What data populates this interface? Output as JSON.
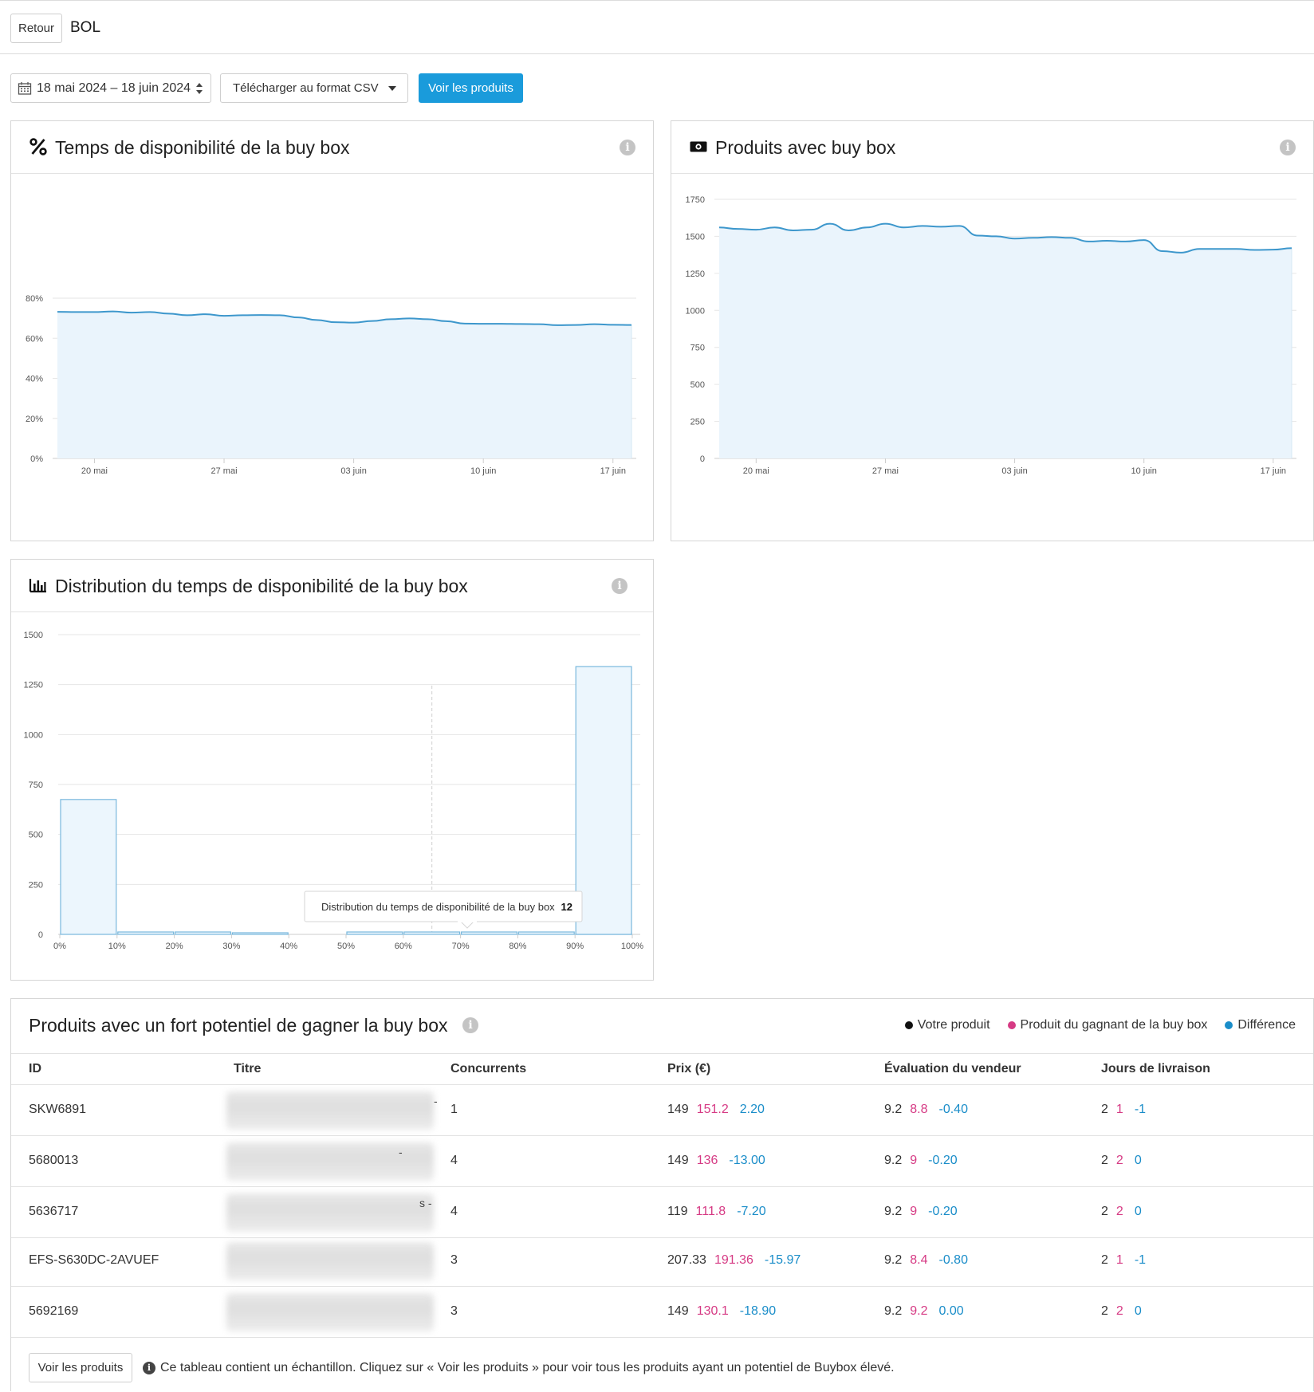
{
  "header": {
    "back_label": "Retour",
    "title": "BOL"
  },
  "toolbar": {
    "date_range": "18 mai 2024 – 18 juin 2024",
    "csv_label": "Télécharger au format CSV",
    "view_products_label": "Voir les produits"
  },
  "colors": {
    "accent": "#1a9bdb",
    "line": "#3d97cc",
    "area": "#eaf4fc",
    "winner": "#d63a84",
    "difference": "#1a8dc9"
  },
  "cards": {
    "availability": {
      "title": "Temps de disponibilité de la buy box",
      "icon": "percent-icon"
    },
    "products": {
      "title": "Produits avec buy box",
      "icon": "money-icon"
    },
    "distribution": {
      "title": "Distribution du temps de disponibilité de la buy box",
      "icon": "bar-chart-icon"
    }
  },
  "chart_data": [
    {
      "type": "area",
      "ylim": [
        0,
        80
      ],
      "y_ticks": [
        "0%",
        "20%",
        "40%",
        "60%",
        "80%"
      ],
      "y_tick_values": [
        0,
        20,
        40,
        60,
        80
      ],
      "x_tick_labels": [
        "20 mai",
        "27 mai",
        "03 juin",
        "10 juin",
        "17 juin"
      ],
      "x_tick_days": [
        2,
        9,
        16,
        23,
        30
      ],
      "x_days": [
        0,
        31
      ],
      "values": [
        73.2,
        73.1,
        73.1,
        73.4,
        72.8,
        73.1,
        72.3,
        71.5,
        72.0,
        71.2,
        71.5,
        71.6,
        71.5,
        70.4,
        69.1,
        68.0,
        67.8,
        68.6,
        69.5,
        69.9,
        69.5,
        68.5,
        67.3,
        67.2,
        67.2,
        67.1,
        67.0,
        66.5,
        66.6,
        67.0,
        66.7,
        66.6
      ]
    },
    {
      "type": "area",
      "ylim": [
        0,
        1750
      ],
      "y_ticks": [
        "0",
        "250",
        "500",
        "750",
        "1000",
        "1250",
        "1500",
        "1750"
      ],
      "y_tick_values": [
        0,
        250,
        500,
        750,
        1000,
        1250,
        1500,
        1750
      ],
      "x_tick_labels": [
        "20 mai",
        "27 mai",
        "03 juin",
        "10 juin",
        "17 juin"
      ],
      "x_tick_days": [
        2,
        9,
        16,
        23,
        30
      ],
      "x_days": [
        0,
        31
      ],
      "values": [
        1560,
        1550,
        1545,
        1560,
        1540,
        1545,
        1585,
        1540,
        1560,
        1585,
        1560,
        1570,
        1565,
        1570,
        1505,
        1500,
        1485,
        1490,
        1495,
        1490,
        1465,
        1470,
        1465,
        1475,
        1400,
        1390,
        1415,
        1415,
        1415,
        1408,
        1410,
        1420
      ]
    },
    {
      "type": "bar",
      "categories": [
        "0%",
        "10%",
        "20%",
        "30%",
        "40%",
        "50%",
        "60%",
        "70%",
        "80%",
        "90%",
        "100%"
      ],
      "values": [
        675,
        12,
        12,
        8,
        0,
        12,
        12,
        12,
        12,
        12,
        1340
      ],
      "ylim": [
        0,
        1500
      ],
      "y_ticks": [
        "0",
        "250",
        "500",
        "750",
        "1000",
        "1250",
        "1500"
      ],
      "y_tick_values": [
        0,
        250,
        500,
        750,
        1000,
        1250,
        1500
      ],
      "tooltip": {
        "label": "Distribution du temps de disponibilité de la buy box",
        "value": "12"
      }
    }
  ],
  "table": {
    "title": "Produits avec un fort potentiel de gagner la buy box",
    "legend": [
      {
        "label": "Votre produit",
        "color": "#111111"
      },
      {
        "label": "Produit du gagnant de la buy box",
        "color": "#d63a84"
      },
      {
        "label": "Différence",
        "color": "#1a8dc9"
      }
    ],
    "columns": [
      "ID",
      "Titre",
      "Concurrents",
      "Prix (€)",
      "Évaluation du vendeur",
      "Jours de livraison"
    ],
    "rows": [
      {
        "id": "SKW6891",
        "title_tail": "-",
        "competitors": "1",
        "price": [
          "149",
          "151.2",
          "2.20"
        ],
        "rating": [
          "9.2",
          "8.8",
          "-0.40"
        ],
        "days": [
          "2",
          "1",
          "-1"
        ]
      },
      {
        "id": "5680013",
        "title_tail": "-",
        "competitors": "4",
        "price": [
          "149",
          "136",
          "-13.00"
        ],
        "rating": [
          "9.2",
          "9",
          "-0.20"
        ],
        "days": [
          "2",
          "2",
          "0"
        ]
      },
      {
        "id": "5636717",
        "title_tail": "s -",
        "competitors": "4",
        "price": [
          "119",
          "111.8",
          "-7.20"
        ],
        "rating": [
          "9.2",
          "9",
          "-0.20"
        ],
        "days": [
          "2",
          "2",
          "0"
        ]
      },
      {
        "id": "EFS-S630DC-2AVUEF",
        "title_tail": "",
        "competitors": "3",
        "price": [
          "207.33",
          "191.36",
          "-15.97"
        ],
        "rating": [
          "9.2",
          "8.4",
          "-0.80"
        ],
        "days": [
          "2",
          "1",
          "-1"
        ]
      },
      {
        "id": "5692169",
        "title_tail": "",
        "competitors": "3",
        "price": [
          "149",
          "130.1",
          "-18.90"
        ],
        "rating": [
          "9.2",
          "9.2",
          "0.00"
        ],
        "days": [
          "2",
          "2",
          "0"
        ]
      }
    ],
    "footer_button": "Voir les produits",
    "footer_note": "Ce tableau contient un échantillon. Cliquez sur « Voir les produits » pour voir tous les produits ayant un potentiel de Buybox élevé."
  }
}
